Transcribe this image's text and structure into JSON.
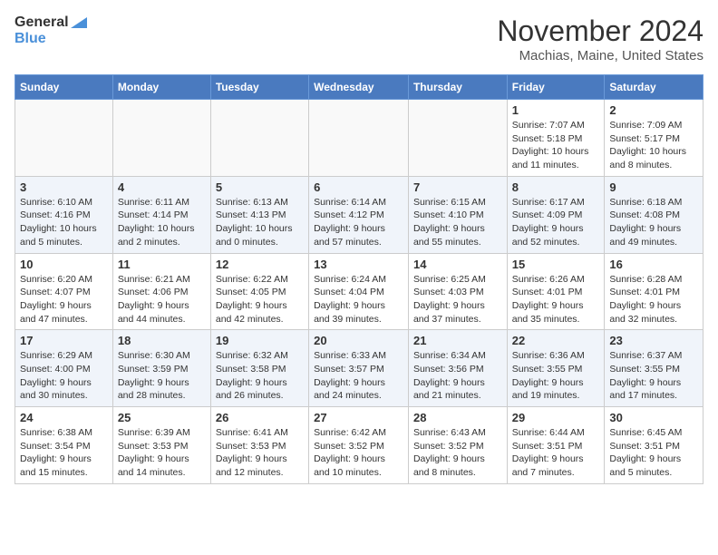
{
  "header": {
    "logo_general": "General",
    "logo_blue": "Blue",
    "month_title": "November 2024",
    "location": "Machias, Maine, United States"
  },
  "days_of_week": [
    "Sunday",
    "Monday",
    "Tuesday",
    "Wednesday",
    "Thursday",
    "Friday",
    "Saturday"
  ],
  "weeks": [
    [
      {
        "day": "",
        "sunrise": "",
        "sunset": "",
        "daylight": ""
      },
      {
        "day": "",
        "sunrise": "",
        "sunset": "",
        "daylight": ""
      },
      {
        "day": "",
        "sunrise": "",
        "sunset": "",
        "daylight": ""
      },
      {
        "day": "",
        "sunrise": "",
        "sunset": "",
        "daylight": ""
      },
      {
        "day": "",
        "sunrise": "",
        "sunset": "",
        "daylight": ""
      },
      {
        "day": "1",
        "sunrise": "Sunrise: 7:07 AM",
        "sunset": "Sunset: 5:18 PM",
        "daylight": "Daylight: 10 hours and 11 minutes."
      },
      {
        "day": "2",
        "sunrise": "Sunrise: 7:09 AM",
        "sunset": "Sunset: 5:17 PM",
        "daylight": "Daylight: 10 hours and 8 minutes."
      }
    ],
    [
      {
        "day": "3",
        "sunrise": "Sunrise: 6:10 AM",
        "sunset": "Sunset: 4:16 PM",
        "daylight": "Daylight: 10 hours and 5 minutes."
      },
      {
        "day": "4",
        "sunrise": "Sunrise: 6:11 AM",
        "sunset": "Sunset: 4:14 PM",
        "daylight": "Daylight: 10 hours and 2 minutes."
      },
      {
        "day": "5",
        "sunrise": "Sunrise: 6:13 AM",
        "sunset": "Sunset: 4:13 PM",
        "daylight": "Daylight: 10 hours and 0 minutes."
      },
      {
        "day": "6",
        "sunrise": "Sunrise: 6:14 AM",
        "sunset": "Sunset: 4:12 PM",
        "daylight": "Daylight: 9 hours and 57 minutes."
      },
      {
        "day": "7",
        "sunrise": "Sunrise: 6:15 AM",
        "sunset": "Sunset: 4:10 PM",
        "daylight": "Daylight: 9 hours and 55 minutes."
      },
      {
        "day": "8",
        "sunrise": "Sunrise: 6:17 AM",
        "sunset": "Sunset: 4:09 PM",
        "daylight": "Daylight: 9 hours and 52 minutes."
      },
      {
        "day": "9",
        "sunrise": "Sunrise: 6:18 AM",
        "sunset": "Sunset: 4:08 PM",
        "daylight": "Daylight: 9 hours and 49 minutes."
      }
    ],
    [
      {
        "day": "10",
        "sunrise": "Sunrise: 6:20 AM",
        "sunset": "Sunset: 4:07 PM",
        "daylight": "Daylight: 9 hours and 47 minutes."
      },
      {
        "day": "11",
        "sunrise": "Sunrise: 6:21 AM",
        "sunset": "Sunset: 4:06 PM",
        "daylight": "Daylight: 9 hours and 44 minutes."
      },
      {
        "day": "12",
        "sunrise": "Sunrise: 6:22 AM",
        "sunset": "Sunset: 4:05 PM",
        "daylight": "Daylight: 9 hours and 42 minutes."
      },
      {
        "day": "13",
        "sunrise": "Sunrise: 6:24 AM",
        "sunset": "Sunset: 4:04 PM",
        "daylight": "Daylight: 9 hours and 39 minutes."
      },
      {
        "day": "14",
        "sunrise": "Sunrise: 6:25 AM",
        "sunset": "Sunset: 4:03 PM",
        "daylight": "Daylight: 9 hours and 37 minutes."
      },
      {
        "day": "15",
        "sunrise": "Sunrise: 6:26 AM",
        "sunset": "Sunset: 4:01 PM",
        "daylight": "Daylight: 9 hours and 35 minutes."
      },
      {
        "day": "16",
        "sunrise": "Sunrise: 6:28 AM",
        "sunset": "Sunset: 4:01 PM",
        "daylight": "Daylight: 9 hours and 32 minutes."
      }
    ],
    [
      {
        "day": "17",
        "sunrise": "Sunrise: 6:29 AM",
        "sunset": "Sunset: 4:00 PM",
        "daylight": "Daylight: 9 hours and 30 minutes."
      },
      {
        "day": "18",
        "sunrise": "Sunrise: 6:30 AM",
        "sunset": "Sunset: 3:59 PM",
        "daylight": "Daylight: 9 hours and 28 minutes."
      },
      {
        "day": "19",
        "sunrise": "Sunrise: 6:32 AM",
        "sunset": "Sunset: 3:58 PM",
        "daylight": "Daylight: 9 hours and 26 minutes."
      },
      {
        "day": "20",
        "sunrise": "Sunrise: 6:33 AM",
        "sunset": "Sunset: 3:57 PM",
        "daylight": "Daylight: 9 hours and 24 minutes."
      },
      {
        "day": "21",
        "sunrise": "Sunrise: 6:34 AM",
        "sunset": "Sunset: 3:56 PM",
        "daylight": "Daylight: 9 hours and 21 minutes."
      },
      {
        "day": "22",
        "sunrise": "Sunrise: 6:36 AM",
        "sunset": "Sunset: 3:55 PM",
        "daylight": "Daylight: 9 hours and 19 minutes."
      },
      {
        "day": "23",
        "sunrise": "Sunrise: 6:37 AM",
        "sunset": "Sunset: 3:55 PM",
        "daylight": "Daylight: 9 hours and 17 minutes."
      }
    ],
    [
      {
        "day": "24",
        "sunrise": "Sunrise: 6:38 AM",
        "sunset": "Sunset: 3:54 PM",
        "daylight": "Daylight: 9 hours and 15 minutes."
      },
      {
        "day": "25",
        "sunrise": "Sunrise: 6:39 AM",
        "sunset": "Sunset: 3:53 PM",
        "daylight": "Daylight: 9 hours and 14 minutes."
      },
      {
        "day": "26",
        "sunrise": "Sunrise: 6:41 AM",
        "sunset": "Sunset: 3:53 PM",
        "daylight": "Daylight: 9 hours and 12 minutes."
      },
      {
        "day": "27",
        "sunrise": "Sunrise: 6:42 AM",
        "sunset": "Sunset: 3:52 PM",
        "daylight": "Daylight: 9 hours and 10 minutes."
      },
      {
        "day": "28",
        "sunrise": "Sunrise: 6:43 AM",
        "sunset": "Sunset: 3:52 PM",
        "daylight": "Daylight: 9 hours and 8 minutes."
      },
      {
        "day": "29",
        "sunrise": "Sunrise: 6:44 AM",
        "sunset": "Sunset: 3:51 PM",
        "daylight": "Daylight: 9 hours and 7 minutes."
      },
      {
        "day": "30",
        "sunrise": "Sunrise: 6:45 AM",
        "sunset": "Sunset: 3:51 PM",
        "daylight": "Daylight: 9 hours and 5 minutes."
      }
    ]
  ]
}
